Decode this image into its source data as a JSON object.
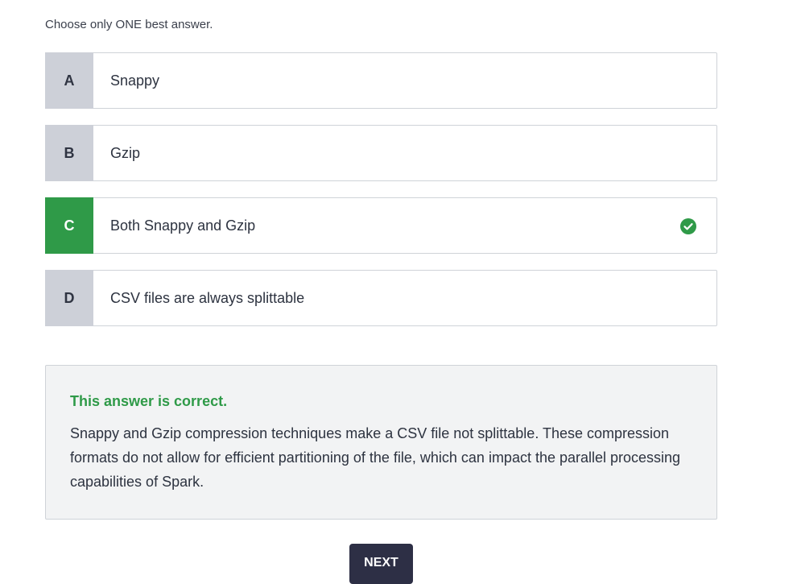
{
  "instruction": "Choose only ONE best answer.",
  "options": [
    {
      "letter": "A",
      "text": "Snappy",
      "state": "default"
    },
    {
      "letter": "B",
      "text": "Gzip",
      "state": "default"
    },
    {
      "letter": "C",
      "text": "Both Snappy and Gzip",
      "state": "correct",
      "icon": "check-circle-icon"
    },
    {
      "letter": "D",
      "text": "CSV files are always splittable",
      "state": "default"
    }
  ],
  "feedback": {
    "verdict": "This answer is correct.",
    "explanation": "Snappy and Gzip compression techniques make a CSV file not splittable. These compression formats do not allow for efficient partitioning of the file, which can impact the parallel processing capabilities of Spark."
  },
  "next_button": {
    "label": "NEXT"
  },
  "colors": {
    "correct": "#2f9a48",
    "letter_bg": "#cdd0d8",
    "button_bg": "#2d2f45",
    "feedback_bg": "#f2f3f4"
  }
}
